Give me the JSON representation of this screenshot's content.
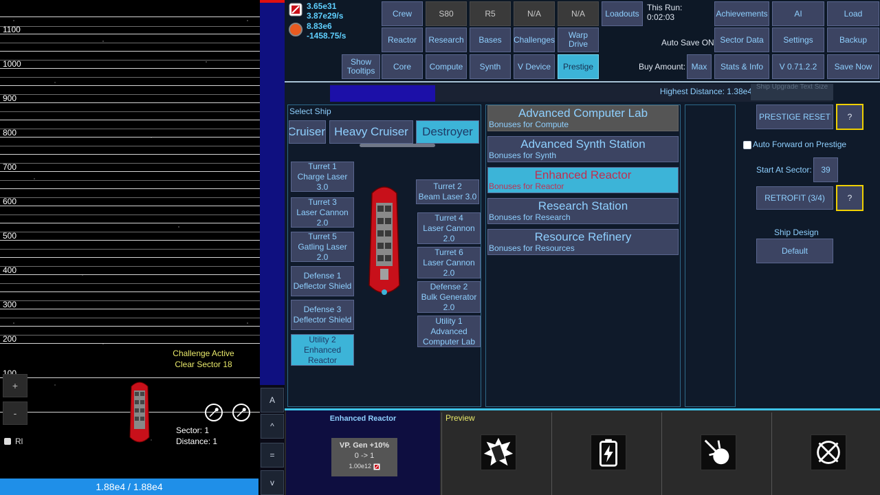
{
  "game": {
    "y_labels": [
      "1100",
      "1000",
      "900",
      "800",
      "700",
      "600",
      "500",
      "400",
      "300",
      "200",
      "100"
    ],
    "challenge_line1": "Challenge Active",
    "challenge_line2": "Clear Sector 18",
    "zoom_in": "+",
    "zoom_out": "-",
    "sector": "Sector: 1",
    "distance": "Distance: 1",
    "rl_label": "Rl",
    "health": "1.88e4 / 1.88e4"
  },
  "side_strip": {
    "a": "A",
    "up": "^",
    "eq": "=",
    "down": "v"
  },
  "resources": {
    "line1": "3.65e31",
    "line2": "3.87e29/s",
    "line3": "8.83e6",
    "line4": "-1458.75/s"
  },
  "nav": {
    "show_tooltips": "Show Tooltips",
    "crew": "Crew",
    "s80": "S80",
    "r5": "R5",
    "na1": "N/A",
    "na2": "N/A",
    "loadouts": "Loadouts",
    "this_run_label": "This Run:",
    "this_run_time": "0:02:03",
    "achievements": "Achievements",
    "ai": "AI",
    "load": "Load",
    "reactor": "Reactor",
    "research": "Research",
    "bases": "Bases",
    "challenges": "Challenges",
    "warp_drive": "Warp Drive",
    "auto_save": "Auto Save ON",
    "sector_data": "Sector Data",
    "settings": "Settings",
    "backup": "Backup",
    "core": "Core",
    "compute": "Compute",
    "synth": "Synth",
    "v_device": "V Device",
    "prestige": "Prestige",
    "buy_amount": "Buy Amount:",
    "max": "Max",
    "stats_info": "Stats & Info",
    "version": "V 0.71.2.2",
    "save_now": "Save Now"
  },
  "distance_bar": {
    "text": "Highest Distance: 1.38e4",
    "progress": 0.21,
    "hint": "Ship Upgrade Text Size"
  },
  "ship": {
    "select_label": "Select Ship",
    "tabs": [
      "Cruiser",
      "Heavy Cruiser",
      "Destroyer"
    ],
    "slots_left": [
      "Turret 1\nCharge Laser 3.0",
      "Turret 3\nLaser Cannon\n2.0",
      "Turret 5\nGatling Laser 2.0",
      "Defense 1\nDeflector Shield",
      "Defense 3\nDeflector Shield",
      "Utility 2\nEnhanced\nReactor"
    ],
    "slots_right": [
      "Turret 2\nBeam Laser 3.0",
      "Turret 4\nLaser Cannon\n2.0",
      "Turret 6\nLaser Cannon\n2.0",
      "Defense 2\nBulk Generator\n2.0",
      "Utility 1\nAdvanced\nComputer Lab"
    ]
  },
  "modules": [
    {
      "title": "Advanced Computer Lab",
      "sub": "Bonuses for Compute"
    },
    {
      "title": "Advanced Synth Station",
      "sub": "Bonuses for Synth"
    },
    {
      "title": "Enhanced Reactor",
      "sub": "Bonuses for Reactor"
    },
    {
      "title": "Research Station",
      "sub": "Bonuses for Research"
    },
    {
      "title": "Resource Refinery",
      "sub": "Bonuses for Resources"
    }
  ],
  "prestige": {
    "reset": "PRESTIGE RESET",
    "q": "?",
    "auto_forward": "Auto Forward on Prestige",
    "start_sector_label": "Start At Sector:",
    "start_sector_value": "39",
    "retrofit": "RETROFIT (3/4)",
    "ship_design_label": "Ship Design",
    "ship_design_value": "Default"
  },
  "bottom": {
    "selected_title": "Enhanced Reactor",
    "card_line1": "VP. Gen +10%",
    "card_line2": "0 -> 1",
    "card_cost": "1.00e12",
    "preview_label": "Preview",
    "preview_icons": [
      "broken-ship-icon",
      "battery-icon",
      "scatter-blast-icon",
      "crossed-orb-icon"
    ]
  },
  "colors": {
    "button_bg": "#3c4462",
    "button_text": "#8fd0ff",
    "active_bg": "#3cb4d8",
    "health_bar": "#1f8fe8",
    "warning_yellow": "#f0d000"
  }
}
